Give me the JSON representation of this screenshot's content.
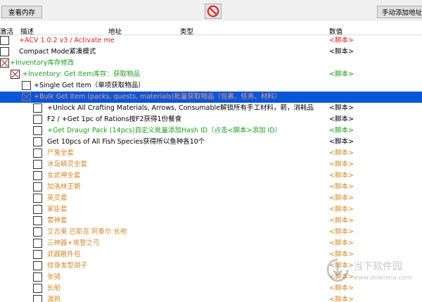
{
  "toolbar": {
    "view_memory_label": "查看内存",
    "add_address_label": "手动添加地址",
    "clear_icon": "no-entry-icon"
  },
  "columns": {
    "active": "激活",
    "description": "描述",
    "address": "地址",
    "type": "类型",
    "value": "数值"
  },
  "colors": {
    "red": "#e02020",
    "green": "#1d9b1d",
    "orange": "#d08a2c",
    "selection": "#0a57d6"
  },
  "rows": [
    {
      "desc": "+ACV 1.0.2 v3 / Activate me",
      "value": "<脚本>",
      "checked": false,
      "selected": false
    },
    {
      "desc": "Compact Mode紧凑模式",
      "value": "<脚本>",
      "checked": false,
      "selected": false
    },
    {
      "desc": "+Inventory库存修改",
      "value": "",
      "checked": true,
      "selected": false
    },
    {
      "desc": "+Inventory: Get Item库存：获取物品",
      "value": "<脚本>",
      "checked": true,
      "selected": false
    },
    {
      "desc": "+Single Get Item（单项获取物品）",
      "value": "",
      "checked": false,
      "selected": false
    },
    {
      "desc": "+Bulk Get Item (packs, quests, materials)批量获取物品（包裹、任务、材料）",
      "value": "",
      "checked": true,
      "selected": true
    },
    {
      "desc": "+Unlock All Crafting Materials, Arrows, Consumable解锁所有手工材料，箭，消耗品",
      "value": "<脚本>",
      "checked": false,
      "selected": false
    },
    {
      "desc": "F2 / +Get 1pc of Rations按F2获得1份餐食",
      "value": "<脚本>",
      "checked": false,
      "selected": false
    },
    {
      "desc": "+Get Draugr Pack (14pcs)自定义批量添加Hash ID（点击<脚本>添加 ID）",
      "value": "<脚本>",
      "checked": false,
      "selected": false
    },
    {
      "desc": "Get 10pcs of All Fish Species获得所以鱼种各10个",
      "value": "<脚本>",
      "checked": false,
      "selected": false
    },
    {
      "desc": "尸鬼全套",
      "value": "<脚本>",
      "checked": false,
      "selected": false
    },
    {
      "desc": "冰岛精灵全套",
      "value": "<脚本>",
      "checked": false,
      "selected": false
    },
    {
      "desc": "女武神全套",
      "value": "<脚本>",
      "checked": false,
      "selected": false
    },
    {
      "desc": "加洛林王朝",
      "value": "<脚本>",
      "checked": false,
      "selected": false
    },
    {
      "desc": "英灵套",
      "value": "<脚本>",
      "checked": false,
      "selected": false
    },
    {
      "desc": "家臣套",
      "value": "<脚本>",
      "checked": false,
      "selected": false
    },
    {
      "desc": "雷神套",
      "value": "<脚本>",
      "checked": false,
      "selected": false
    },
    {
      "desc": "艾吉奥 巴耶克 阿泰尔 长袍",
      "value": "<脚本>",
      "checked": false,
      "selected": false
    },
    {
      "desc": "三神器+埃登之弓",
      "value": "<脚本>",
      "checked": false,
      "selected": false
    },
    {
      "desc": "武器散件包",
      "value": "<脚本>",
      "checked": false,
      "selected": false
    },
    {
      "desc": "纹身发型胡子",
      "value": "<脚本>",
      "checked": false,
      "selected": false
    },
    {
      "desc": "坐骑",
      "value": "<脚本>",
      "checked": false,
      "selected": false
    },
    {
      "desc": "长船",
      "value": "<脚本>",
      "checked": false,
      "selected": false
    },
    {
      "desc": "渡鸦",
      "value": "<脚本>",
      "checked": false,
      "selected": false
    }
  ],
  "watermark": {
    "title": "当下软件园",
    "url": "www.downxia.com",
    "icon": "downxia-logo-icon"
  }
}
